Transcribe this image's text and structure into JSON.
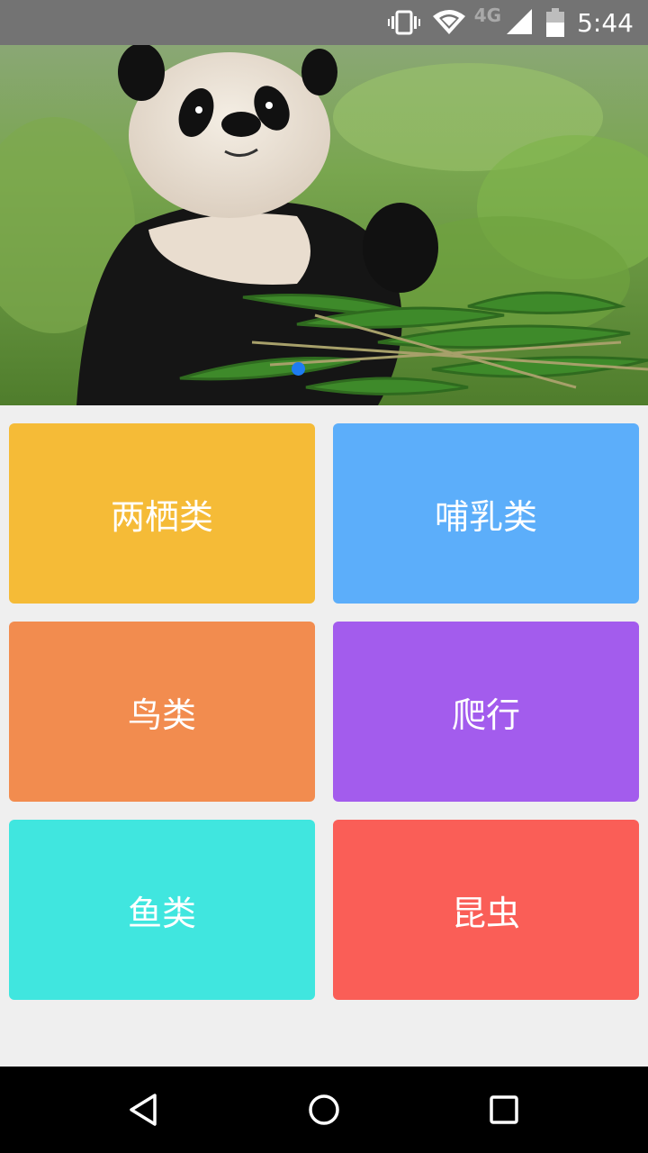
{
  "status_bar": {
    "network_label": "4G",
    "time": "5:44",
    "icons": [
      "vibrate-icon",
      "wifi-icon",
      "signal-icon",
      "battery-icon"
    ]
  },
  "banner": {
    "image": "panda-photo",
    "page_indicator": {
      "count": 1,
      "active": 0,
      "color": "#1e7cf2"
    }
  },
  "categories": [
    {
      "label": "两栖类",
      "color": "#f5bb37"
    },
    {
      "label": "哺乳类",
      "color": "#5caefa"
    },
    {
      "label": "鸟类",
      "color": "#f28c4f"
    },
    {
      "label": "爬行",
      "color": "#a35ced"
    },
    {
      "label": "鱼类",
      "color": "#40e6df"
    },
    {
      "label": "昆虫",
      "color": "#fa5e57"
    }
  ],
  "nav_bar": {
    "icons": [
      "back-icon",
      "home-icon",
      "recents-icon"
    ]
  }
}
